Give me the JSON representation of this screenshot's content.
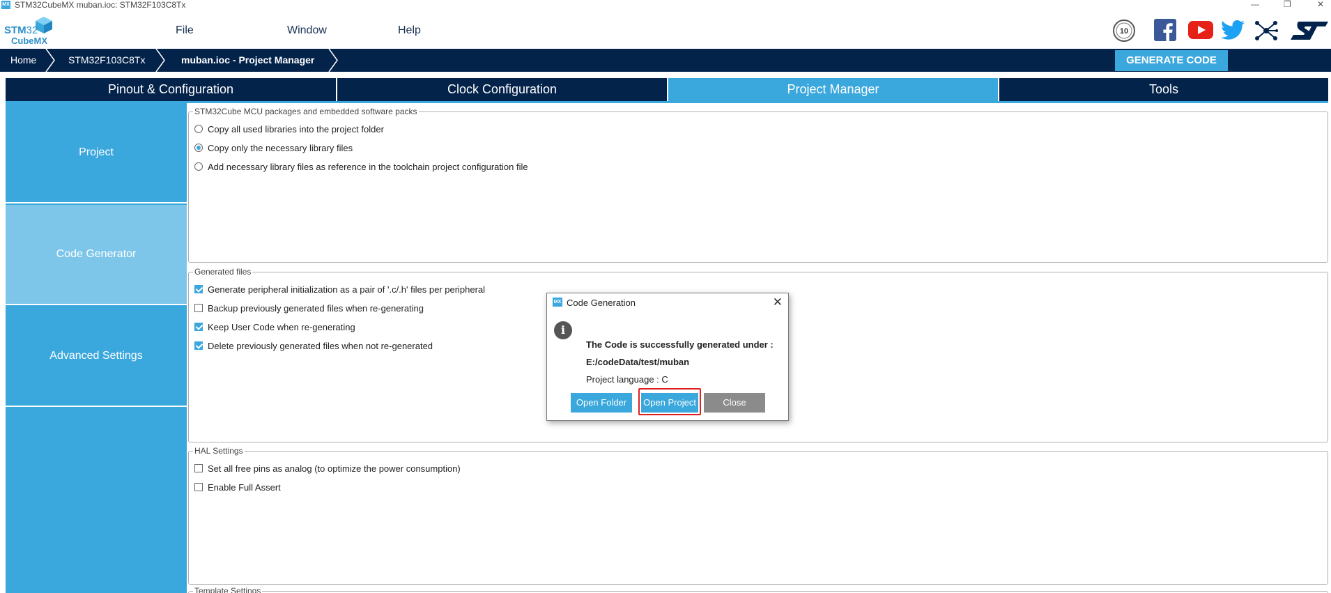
{
  "window": {
    "title": "STM32CubeMX muban.ioc: STM32F103C8Tx",
    "icon": "MX",
    "controls": [
      "—",
      "❐",
      "✕"
    ]
  },
  "logo": {
    "line1_bold": "STM",
    "line1_num": "32",
    "line2": "CubeMX"
  },
  "menu": {
    "file": "File",
    "window": "Window",
    "help": "Help"
  },
  "social": {
    "badge_text": "10",
    "icons": [
      "anniversary-badge-icon",
      "facebook-icon",
      "youtube-icon",
      "twitter-icon",
      "network-icon",
      "st-logo-icon"
    ]
  },
  "breadcrumb": {
    "home": "Home",
    "mcu": "STM32F103C8Tx",
    "page": "muban.ioc - Project Manager"
  },
  "generate_button": "GENERATE CODE",
  "tabs": [
    {
      "label": "Pinout & Configuration",
      "active": false
    },
    {
      "label": "Clock Configuration",
      "active": false
    },
    {
      "label": "Project Manager",
      "active": true
    },
    {
      "label": "Tools",
      "active": false
    }
  ],
  "sidebar": [
    {
      "label": "Project",
      "active": false
    },
    {
      "label": "Code Generator",
      "active": true
    },
    {
      "label": "Advanced Settings",
      "active": false
    }
  ],
  "packages": {
    "legend": "STM32Cube MCU packages and embedded software packs",
    "options": [
      {
        "label": "Copy all used libraries into the project folder",
        "selected": false
      },
      {
        "label": "Copy only the necessary library files",
        "selected": true
      },
      {
        "label": "Add necessary library files as reference in the toolchain project configuration file",
        "selected": false
      }
    ]
  },
  "generated_files": {
    "legend": "Generated files",
    "options": [
      {
        "label": "Generate peripheral initialization as a pair of '.c/.h' files per peripheral",
        "checked": true
      },
      {
        "label": "Backup previously generated files when re-generating",
        "checked": false
      },
      {
        "label": "Keep User Code when re-generating",
        "checked": true
      },
      {
        "label": "Delete previously generated files when not re-generated",
        "checked": true
      }
    ]
  },
  "hal_settings": {
    "legend": "HAL Settings",
    "options": [
      {
        "label": "Set all free pins as analog (to optimize the power consumption)",
        "checked": false
      },
      {
        "label": "Enable Full Assert",
        "checked": false
      }
    ]
  },
  "template_settings": {
    "legend": "Template Settings"
  },
  "dialog": {
    "title": "Code Generation",
    "icon": "MX",
    "message_line1": "The Code is successfully generated under :",
    "message_line2": "E:/codeData/test/muban",
    "language": "Project language : C",
    "buttons": {
      "open_folder": "Open Folder",
      "open_project": "Open Project",
      "close": "Close"
    }
  },
  "colors": {
    "navy": "#03234b",
    "accent": "#3aa7dd",
    "active_side": "#7dc6ea",
    "highlight": "#e02020"
  }
}
